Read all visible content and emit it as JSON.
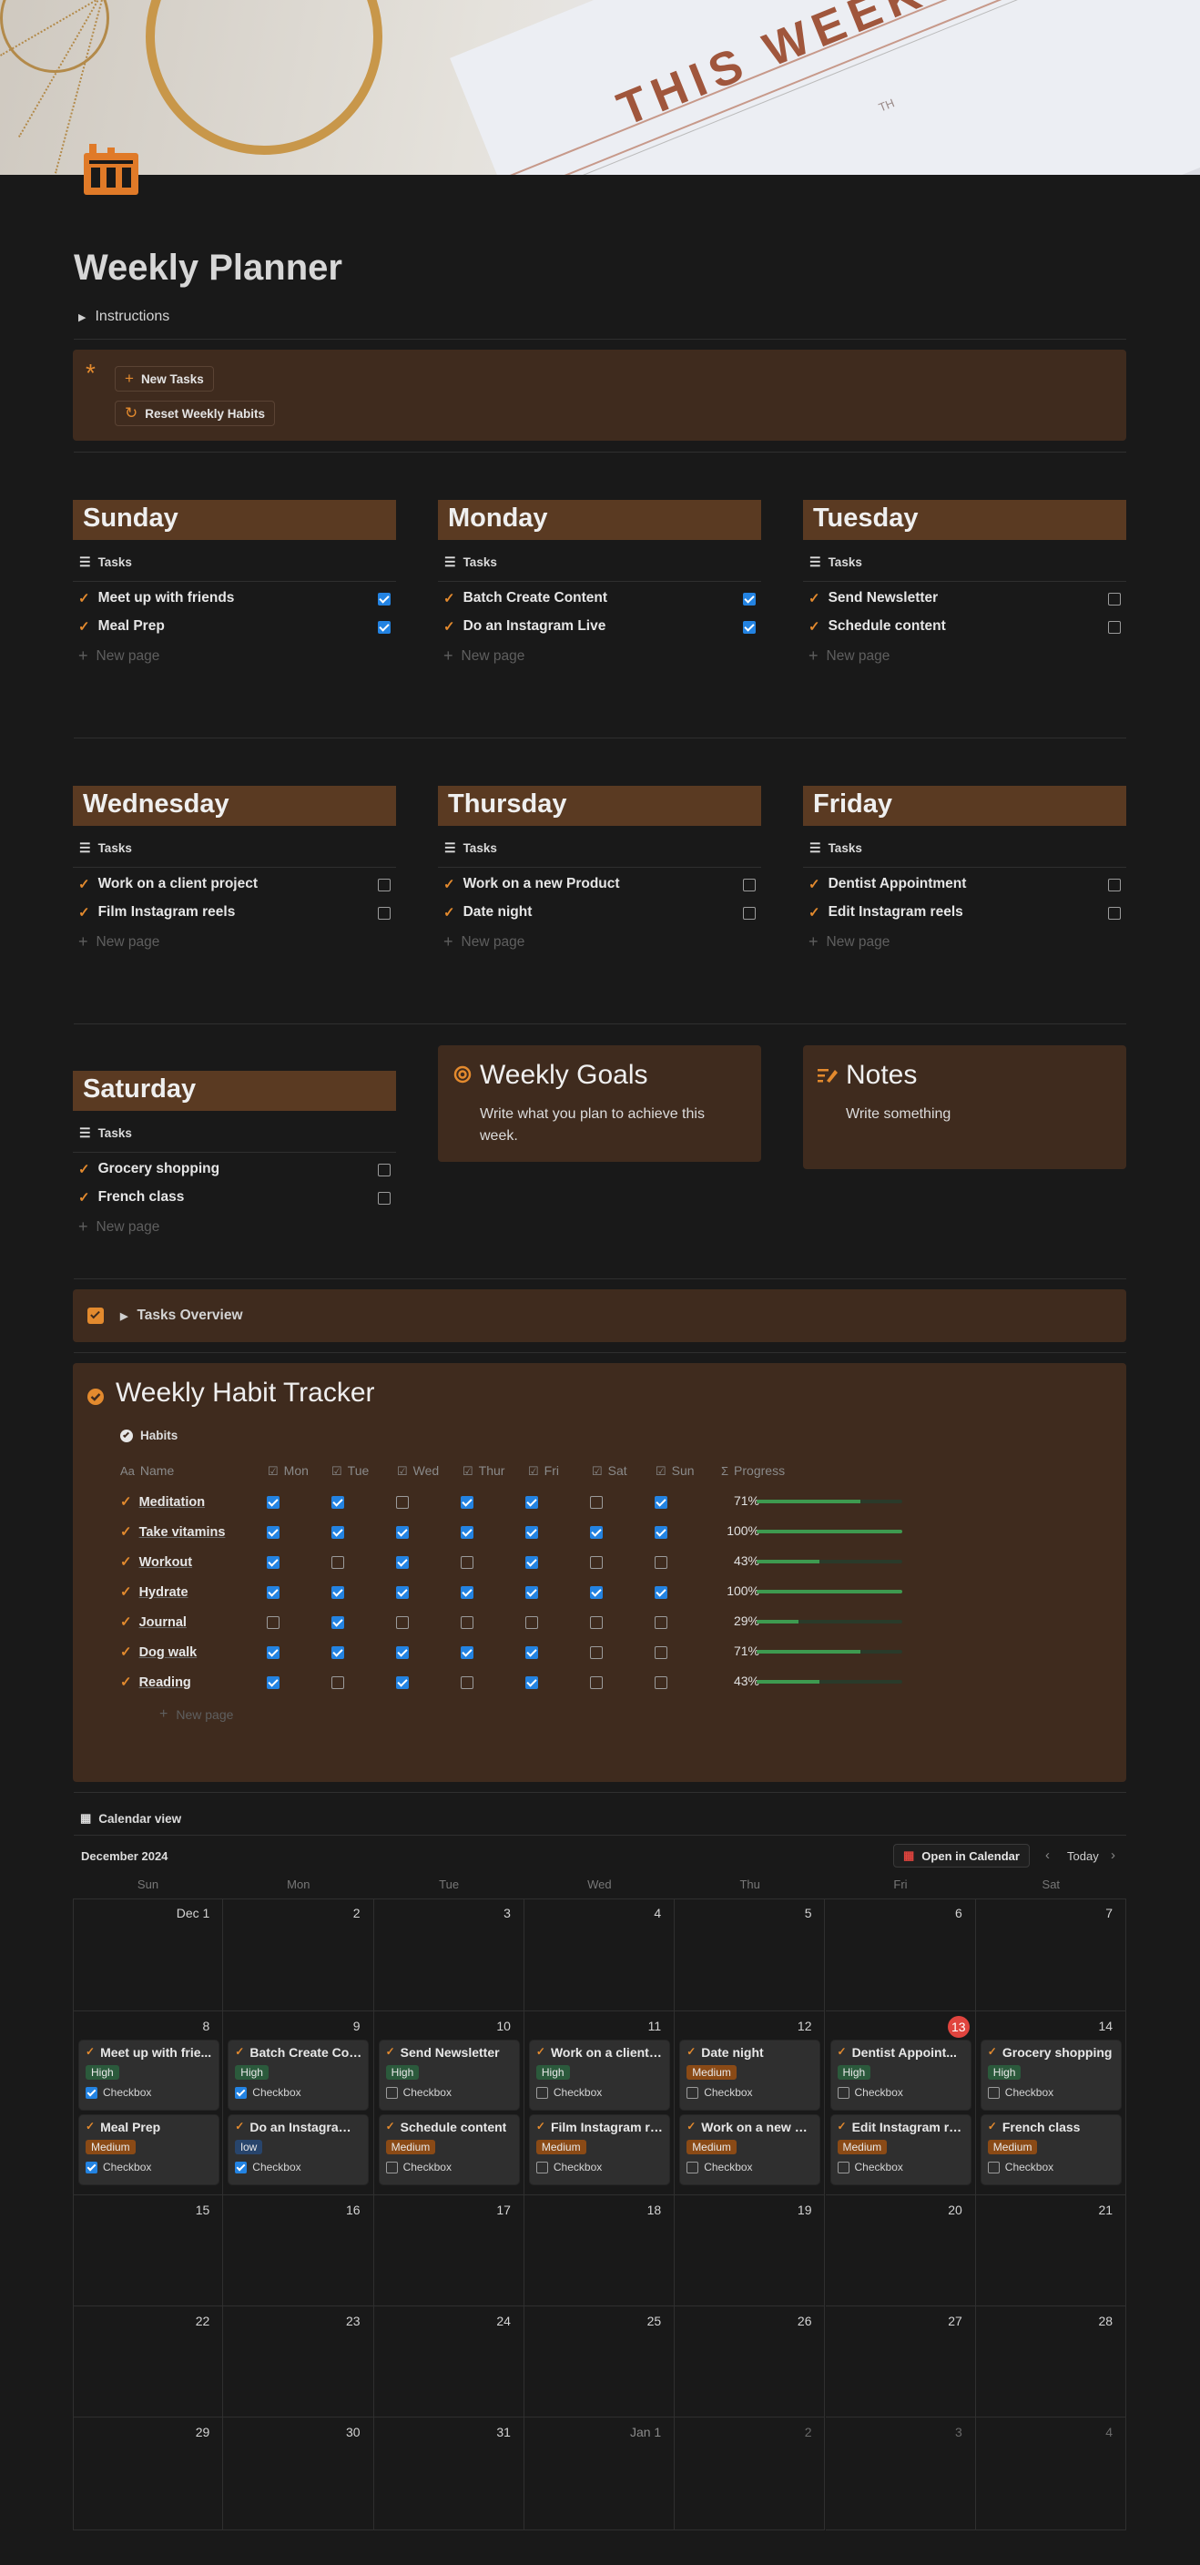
{
  "page": {
    "title": "Weekly Planner",
    "instructions_label": "Instructions",
    "buttons": {
      "new_tasks": "New Tasks",
      "reset_habits": "Reset Weekly Habits"
    },
    "cover_text": "THIS WEEK",
    "cover_sub": "TH"
  },
  "days": [
    {
      "name": "Sunday",
      "view": "Tasks",
      "tasks": [
        {
          "name": "Meet up with friends",
          "done": true
        },
        {
          "name": "Meal Prep",
          "done": true
        }
      ]
    },
    {
      "name": "Monday",
      "view": "Tasks",
      "tasks": [
        {
          "name": "Batch Create Content",
          "done": true
        },
        {
          "name": "Do an Instagram Live",
          "done": true
        }
      ]
    },
    {
      "name": "Tuesday",
      "view": "Tasks",
      "tasks": [
        {
          "name": "Send Newsletter",
          "done": false
        },
        {
          "name": "Schedule content",
          "done": false
        }
      ]
    },
    {
      "name": "Wednesday",
      "view": "Tasks",
      "tasks": [
        {
          "name": "Work on a client project",
          "done": false
        },
        {
          "name": "Film Instagram reels",
          "done": false
        }
      ]
    },
    {
      "name": "Thursday",
      "view": "Tasks",
      "tasks": [
        {
          "name": "Work on a new Product",
          "done": false
        },
        {
          "name": "Date night",
          "done": false
        }
      ]
    },
    {
      "name": "Friday",
      "view": "Tasks",
      "tasks": [
        {
          "name": "Dentist Appointment",
          "done": false
        },
        {
          "name": "Edit Instagram reels",
          "done": false
        }
      ]
    },
    {
      "name": "Saturday",
      "view": "Tasks",
      "tasks": [
        {
          "name": "Grocery shopping",
          "done": false
        },
        {
          "name": "French class",
          "done": false
        }
      ]
    }
  ],
  "new_page_label": "New page",
  "goals": {
    "title": "Weekly Goals",
    "text": "Write what you plan to achieve this week."
  },
  "notes": {
    "title": "Notes",
    "text": "Write something"
  },
  "tasks_overview": "Tasks Overview",
  "habits": {
    "title": "Weekly Habit Tracker",
    "view": "Habits",
    "columns": [
      "Name",
      "Mon",
      "Tue",
      "Wed",
      "Thur",
      "Fri",
      "Sat",
      "Sun",
      "Progress"
    ],
    "rows": [
      {
        "name": "Meditation",
        "checks": [
          true,
          true,
          false,
          true,
          true,
          false,
          true
        ],
        "progress": "71%",
        "value": 0.71
      },
      {
        "name": "Take vitamins",
        "checks": [
          true,
          true,
          true,
          true,
          true,
          true,
          true
        ],
        "progress": "100%",
        "value": 1.0
      },
      {
        "name": "Workout",
        "checks": [
          true,
          false,
          true,
          false,
          true,
          false,
          false
        ],
        "progress": "43%",
        "value": 0.43
      },
      {
        "name": "Hydrate",
        "checks": [
          true,
          true,
          true,
          true,
          true,
          true,
          true
        ],
        "progress": "100%",
        "value": 1.0
      },
      {
        "name": "Journal",
        "checks": [
          false,
          true,
          false,
          false,
          false,
          false,
          false
        ],
        "progress": "29%",
        "value": 0.29
      },
      {
        "name": "Dog walk",
        "checks": [
          true,
          true,
          true,
          true,
          true,
          false,
          false
        ],
        "progress": "71%",
        "value": 0.71
      },
      {
        "name": "Reading",
        "checks": [
          true,
          false,
          true,
          false,
          true,
          false,
          false
        ],
        "progress": "43%",
        "value": 0.43
      }
    ]
  },
  "calendar": {
    "view": "Calendar view",
    "month": "December 2024",
    "open_label": "Open in Calendar",
    "today_label": "Today",
    "weekdays": [
      "Sun",
      "Mon",
      "Tue",
      "Wed",
      "Thu",
      "Fri",
      "Sat"
    ],
    "weeks": [
      [
        "Dec 1",
        "2",
        "3",
        "4",
        "5",
        "6",
        "7"
      ],
      [
        "8",
        "9",
        "10",
        "11",
        "12",
        "13",
        "14"
      ],
      [
        "15",
        "16",
        "17",
        "18",
        "19",
        "20",
        "21"
      ],
      [
        "22",
        "23",
        "24",
        "25",
        "26",
        "27",
        "28"
      ],
      [
        "29",
        "30",
        "31",
        "Jan 1",
        "2",
        "3",
        "4"
      ]
    ],
    "today": "13",
    "checkbox_label": "Checkbox",
    "events": [
      [
        {
          "t": "Meet up with frie...",
          "p": "High",
          "c": true
        },
        {
          "t": "Meal Prep",
          "p": "Medium",
          "c": true
        }
      ],
      [
        {
          "t": "Batch Create Con...",
          "p": "High",
          "c": true
        },
        {
          "t": "Do an Instagram ...",
          "p": "low",
          "c": true
        }
      ],
      [
        {
          "t": "Send Newsletter",
          "p": "High",
          "c": false
        },
        {
          "t": "Schedule content",
          "p": "Medium",
          "c": false
        }
      ],
      [
        {
          "t": "Work on a client ...",
          "p": "High",
          "c": false
        },
        {
          "t": "Film Instagram re...",
          "p": "Medium",
          "c": false
        }
      ],
      [
        {
          "t": "Date night",
          "p": "Medium",
          "c": false
        },
        {
          "t": "Work on a new Pr...",
          "p": "Medium",
          "c": false
        }
      ],
      [
        {
          "t": "Dentist Appoint...",
          "p": "High",
          "c": false
        },
        {
          "t": "Edit Instagram re...",
          "p": "Medium",
          "c": false
        }
      ],
      [
        {
          "t": "Grocery shopping",
          "p": "High",
          "c": false
        },
        {
          "t": "French class",
          "p": "Medium",
          "c": false
        }
      ]
    ]
  },
  "colors": {
    "accent": "#e38a2e",
    "callout": "#3f2b1e",
    "day_header": "#5a3a22",
    "checkbox": "#2383e2",
    "progress": "#3e9a50",
    "today": "#e0443e"
  }
}
